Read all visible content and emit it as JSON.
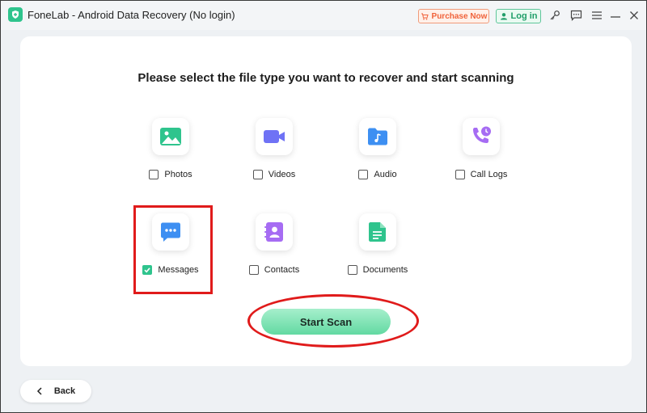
{
  "window": {
    "title": "FoneLab - Android Data Recovery (No login)"
  },
  "titlebar": {
    "purchase_label": "Purchase Now",
    "login_label": "Log in",
    "icons": [
      "key-icon",
      "feedback-icon",
      "menu-icon",
      "minimize-icon",
      "close-icon"
    ]
  },
  "main": {
    "heading": "Please select the file type you want to recover and start scanning",
    "file_types": [
      {
        "label": "Photos",
        "checked": false,
        "icon": "photos-icon",
        "color": "#2fc48d"
      },
      {
        "label": "Videos",
        "checked": false,
        "icon": "videos-icon",
        "color": "#6f72f5"
      },
      {
        "label": "Audio",
        "checked": false,
        "icon": "audio-icon",
        "color": "#3d8ff2"
      },
      {
        "label": "Call Logs",
        "checked": false,
        "icon": "call-logs-icon",
        "color": "#a66cf3"
      },
      {
        "label": "Messages",
        "checked": true,
        "icon": "messages-icon",
        "color": "#3d8ff2"
      },
      {
        "label": "Contacts",
        "checked": false,
        "icon": "contacts-icon",
        "color": "#a66cf3"
      },
      {
        "label": "Documents",
        "checked": false,
        "icon": "documents-icon",
        "color": "#2fc48d"
      }
    ],
    "start_scan_label": "Start Scan"
  },
  "footer": {
    "back_label": "Back"
  },
  "colors": {
    "accent": "#2fc48d",
    "highlight": "#e01b1b",
    "purchase": "#f0623a"
  }
}
